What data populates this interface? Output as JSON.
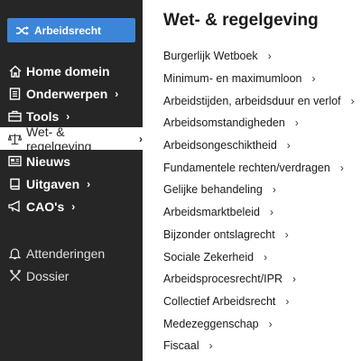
{
  "sidebar": {
    "domain_button": {
      "label": "Arbeidsrecht",
      "icon": "shuffle-icon",
      "color": "#3c86d8"
    },
    "items": [
      {
        "label": "Home domein",
        "icon": "home-icon",
        "chevron": ""
      },
      {
        "label": "Onderwerpen",
        "icon": "document-icon",
        "chevron": "›"
      },
      {
        "label": "Tools",
        "icon": "briefcase-icon",
        "chevron": "›"
      },
      {
        "label": "Wet- & regelgeving",
        "icon": "scales-icon",
        "chevron": "›",
        "active": true
      },
      {
        "label": "Nieuws",
        "icon": "newspaper-icon",
        "chevron": ""
      },
      {
        "label": "Uitgaven",
        "icon": "book-icon",
        "chevron": "›"
      },
      {
        "label": "CAO's",
        "icon": "megaphone-icon",
        "chevron": "›"
      }
    ],
    "secondary": [
      {
        "label": "Attenderingen",
        "icon": "bell-icon"
      },
      {
        "label": "Dossier",
        "icon": "tools-icon"
      }
    ],
    "background": "#262626"
  },
  "main": {
    "title": "Wet- & regelgeving",
    "chevron": "›",
    "items": [
      "Burgerlijk Wetboek",
      "Minimum- en maximumloon",
      "Arbeidstijden, arbeidsduur en verlof",
      "Arbeidsomstandigheden",
      "Arbeidsongeschiktheid",
      "Fundamentele rechten/verdragen",
      "Gelijke behandeling",
      "Arbeidsmarktbeleid",
      "Bijzonder ontslagrecht",
      "Sociale Zekerheid",
      "Arbeidsprocesrecht/IPR",
      "Collectief Arbeidsrecht",
      "Medezeggenschap",
      "Fiscaal"
    ]
  }
}
